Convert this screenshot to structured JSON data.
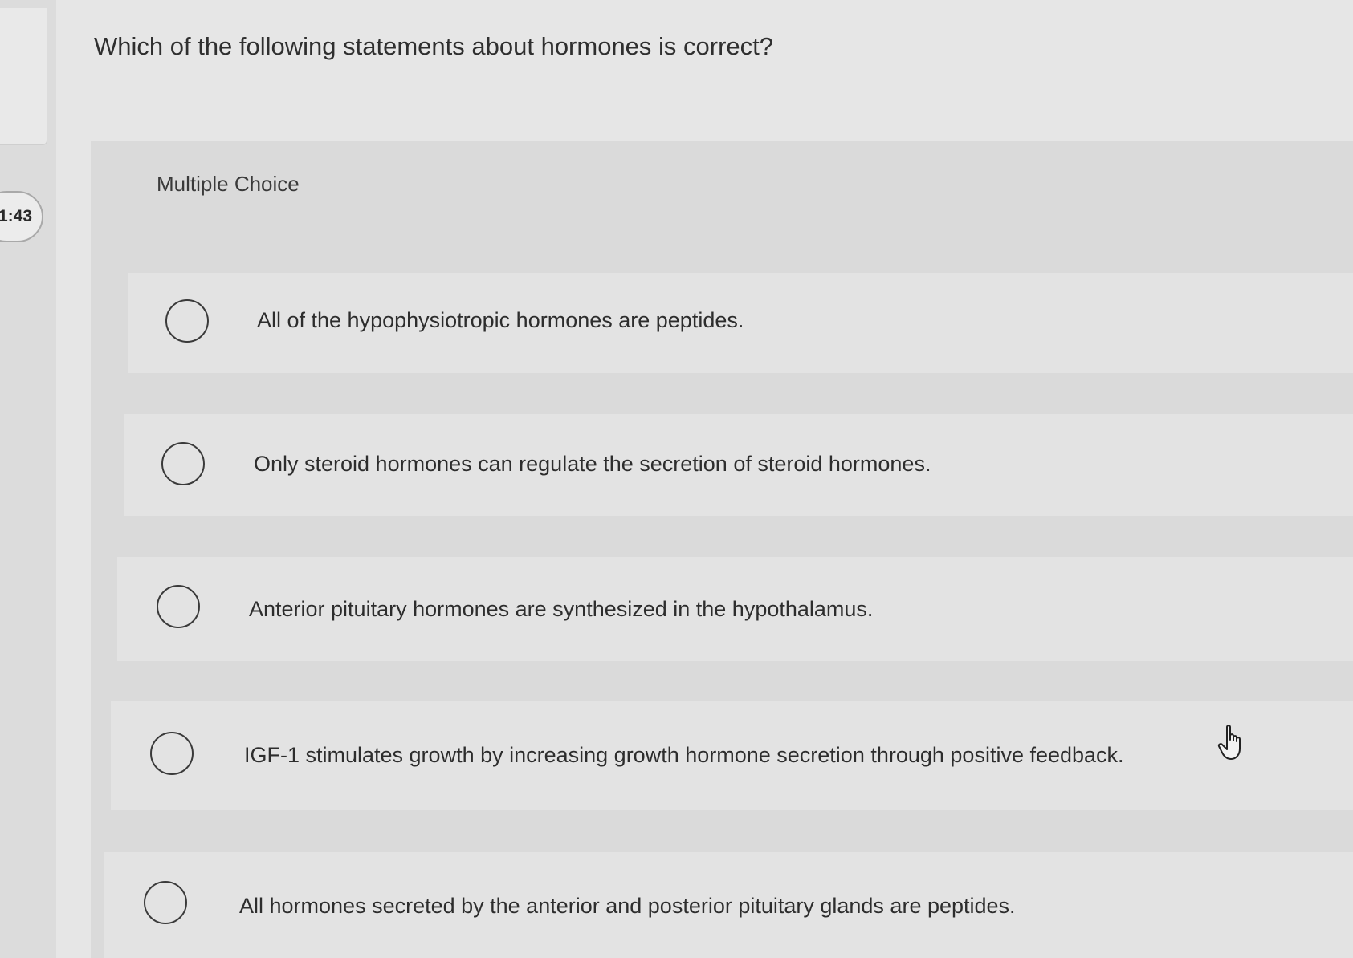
{
  "sidebar": {
    "top_glyph": ")",
    "timer": "1:43"
  },
  "question": {
    "text": "Which of the following statements about hormones is correct?"
  },
  "question_type": "Multiple Choice",
  "options": [
    {
      "label": "All of the hypophysiotropic hormones are peptides.",
      "selected": false
    },
    {
      "label": "Only steroid hormones can regulate the secretion of steroid hormones.",
      "selected": false
    },
    {
      "label": "Anterior pituitary hormones are synthesized in the hypothalamus.",
      "selected": false
    },
    {
      "label": "IGF-1 stimulates growth by increasing growth hormone secretion through positive feedback.",
      "selected": false
    },
    {
      "label": "All hormones secreted by the anterior and posterior pituitary glands are peptides.",
      "selected": false
    }
  ],
  "icons": {
    "cursor": "hand-pointer-icon",
    "radio": "radio-unchecked-icon"
  }
}
